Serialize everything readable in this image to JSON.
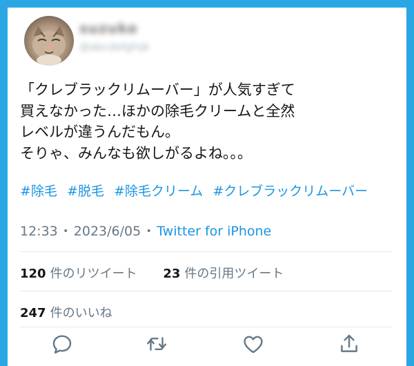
{
  "user": {
    "display_name": "suzuko",
    "handle": "@abcdefghijk"
  },
  "tweet": {
    "lines": [
      "「クレブラックリムーバー」が人気すぎて",
      "買えなかった…ほかの除毛クリームと全然",
      "レベルが違うんだもん。",
      "そりゃ、みんなも欲しがるよね。。。"
    ],
    "hashtags": [
      "#除毛",
      "#脱毛",
      "#除毛クリーム",
      "#クレブラックリムーバー"
    ]
  },
  "meta": {
    "time": "12:33",
    "date": "2023/6/05",
    "separator": "・",
    "source": "Twitter for iPhone"
  },
  "stats": {
    "retweets": {
      "count": "120",
      "label": "件のリツイート"
    },
    "quotes": {
      "count": "23",
      "label": "件の引用ツイート"
    },
    "likes": {
      "count": "247",
      "label": "件のいいね"
    }
  },
  "actions": {
    "icons": [
      "reply-icon",
      "retweet-icon",
      "like-icon",
      "share-icon"
    ]
  },
  "colors": {
    "frame": "#2aa6e4",
    "link": "#1b95e0",
    "text": "#14171a",
    "secondary": "#657786",
    "icon": "#657786"
  }
}
